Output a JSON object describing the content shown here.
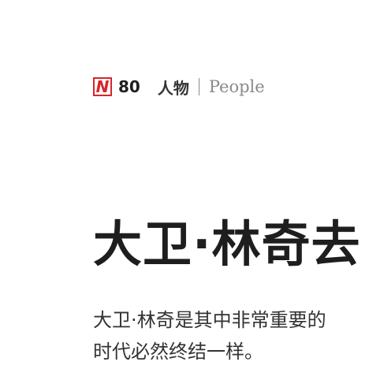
{
  "header": {
    "logo_letter": "N",
    "page_number": "80",
    "section_cn": "人物",
    "section_en": "People"
  },
  "colors": {
    "logo_red": "#d7262b",
    "text_dark": "#1e1e1e",
    "text_gray": "#8a8a8a"
  },
  "article": {
    "headline": "大卫·林奇去",
    "body_lines": [
      "大卫·林奇是其中非常重要的",
      "时代必然终结一样。"
    ]
  }
}
